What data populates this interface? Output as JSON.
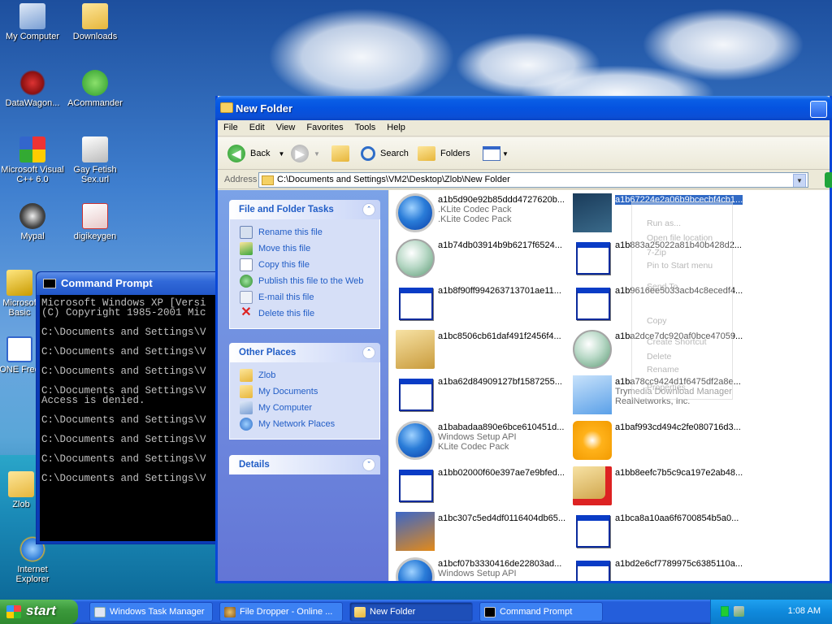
{
  "desktop": {
    "icons": [
      {
        "label": "My Computer"
      },
      {
        "label": "Downloads"
      },
      {
        "label": "DataWagon..."
      },
      {
        "label": "ACommander"
      },
      {
        "label": "Microsoft Visual C++ 6.0"
      },
      {
        "label": "Gay Fetish Sex.url"
      },
      {
        "label": "Mypal"
      },
      {
        "label": "digikeygen"
      },
      {
        "label": "Microsof Basic"
      },
      {
        "label": "ONE Free"
      },
      {
        "label": "Zlob"
      },
      {
        "label": "Internet Explorer"
      }
    ]
  },
  "cmd": {
    "title": "Command Prompt",
    "lines": [
      "Microsoft Windows XP [Versi",
      "(C) Copyright 1985-2001 Mic",
      "",
      "C:\\Documents and Settings\\V",
      "",
      "C:\\Documents and Settings\\V",
      "",
      "C:\\Documents and Settings\\V",
      "",
      "C:\\Documents and Settings\\V",
      "Access is denied.",
      "",
      "C:\\Documents and Settings\\V",
      "",
      "C:\\Documents and Settings\\V",
      "",
      "C:\\Documents and Settings\\V",
      "",
      "C:\\Documents and Settings\\V"
    ]
  },
  "explorer": {
    "title": "New Folder",
    "menu": [
      "File",
      "Edit",
      "View",
      "Favorites",
      "Tools",
      "Help"
    ],
    "toolbar": {
      "back": "Back",
      "search": "Search",
      "folders": "Folders"
    },
    "address": {
      "label": "Address",
      "value": "C:\\Documents and Settings\\VM2\\Desktop\\Zlob\\New Folder"
    },
    "tasks": {
      "title": "File and Folder Tasks",
      "items": [
        "Rename this file",
        "Move this file",
        "Copy this file",
        "Publish this file to the Web",
        "E-mail this file",
        "Delete this file"
      ]
    },
    "places": {
      "title": "Other Places",
      "items": [
        "Zlob",
        "My Documents",
        "My Computer",
        "My Network Places"
      ]
    },
    "details": {
      "title": "Details"
    },
    "files": [
      {
        "name": "a1b5d90e92b85ddd4727620b...",
        "sub1": ".KLite Codec Pack",
        "sub2": ".KLite Codec Pack",
        "icon": "wmp"
      },
      {
        "name": "a1b67224e2a06b9bcecbf4cb1...",
        "sub1": "",
        "sub2": "",
        "icon": "app-ix",
        "selected": true
      },
      {
        "name": "a1b74db03914b9b6217f6524...",
        "sub1": "",
        "sub2": "",
        "icon": "nsis"
      },
      {
        "name": "a1b883a25022a81b40b428d2...",
        "sub1": "",
        "sub2": "",
        "icon": "appwin"
      },
      {
        "name": "a1b8f90ff994263713701ae11...",
        "sub1": "",
        "sub2": "",
        "icon": "appwin"
      },
      {
        "name": "a1b9616ee5033acb4c8ecedf4...",
        "sub1": "",
        "sub2": "",
        "icon": "appwin"
      },
      {
        "name": "a1bc8506cb61daf491f2456f4...",
        "sub1": "",
        "sub2": "",
        "icon": "installer"
      },
      {
        "name": "a1ba2dce7dc920af0bce47059...",
        "sub1": "",
        "sub2": "",
        "icon": "nsis"
      },
      {
        "name": "a1ba62d84909127bf1587255...",
        "sub1": "",
        "sub2": "",
        "icon": "appwin"
      },
      {
        "name": "a1ba78cc9424d1f6475df2a8e...",
        "sub1": "Trymedia Download Manager",
        "sub2": "RealNetworks, Inc.",
        "icon": "trymedia"
      },
      {
        "name": "a1babadaa890e6bce610451d...",
        "sub1": "Windows Setup API",
        "sub2": "KLite Codec Pack",
        "icon": "wmp"
      },
      {
        "name": "a1baf993cd494c2fe080716d3...",
        "sub1": "",
        "sub2": "",
        "icon": "player-orange"
      },
      {
        "name": "a1bb02000f60e397ae7e9bfed...",
        "sub1": "",
        "sub2": "",
        "icon": "appwin"
      },
      {
        "name": "a1bb8eefc7b5c9ca197e2ab48...",
        "sub1": "",
        "sub2": "",
        "icon": "installer-x"
      },
      {
        "name": "a1bc307c5ed4df0116404db65...",
        "sub1": "",
        "sub2": "",
        "icon": "arcade"
      },
      {
        "name": "a1bca8a10aa6f6700854b5a0...",
        "sub1": "",
        "sub2": "",
        "icon": "appwin"
      },
      {
        "name": "a1bcf07b3330416de22803ad...",
        "sub1": "Windows Setup API",
        "sub2": "",
        "icon": "wmp"
      },
      {
        "name": "a1bd2e6cf7789975c6385110a...",
        "sub1": "",
        "sub2": "",
        "icon": "appwin"
      }
    ]
  },
  "ghost_menu": [
    "Run as...",
    "Open file location",
    "7-Zip",
    "Pin to Start menu",
    "Send To",
    "Copy",
    "Create Shortcut",
    "Delete",
    "Rename",
    "Properties"
  ],
  "taskbar": {
    "start": "start",
    "tasks": [
      {
        "label": "Windows Task Manager"
      },
      {
        "label": "File Dropper - Online ..."
      },
      {
        "label": "New Folder",
        "active": true
      },
      {
        "label": "Command Prompt"
      }
    ],
    "clock": "1:08 AM"
  }
}
